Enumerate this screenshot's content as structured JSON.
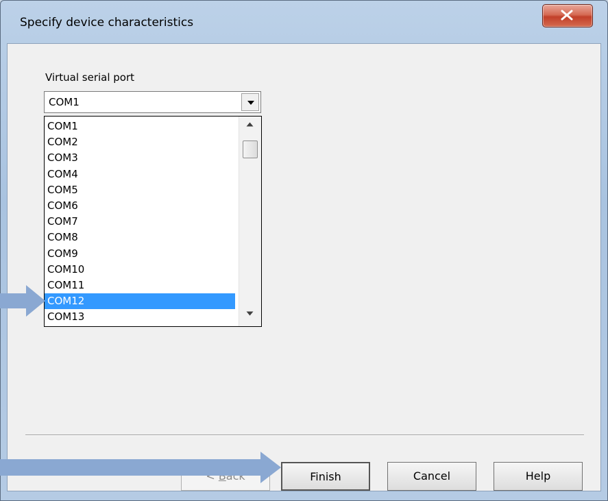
{
  "window": {
    "title": "Specify device characteristics",
    "close_glyph": "x"
  },
  "serial_port": {
    "label": "Virtual serial port",
    "selected_value": "COM1",
    "options": [
      "COM1",
      "COM2",
      "COM3",
      "COM4",
      "COM5",
      "COM6",
      "COM7",
      "COM8",
      "COM9",
      "COM10",
      "COM11",
      "COM12",
      "COM13"
    ],
    "highlighted": "COM12"
  },
  "buttons": {
    "back_prefix": "< ",
    "back_underlined": "B",
    "back_rest": "ack",
    "finish": "Finish",
    "cancel": "Cancel",
    "help": "Help"
  },
  "colors": {
    "selection": "#3399ff",
    "annotation_arrow": "#8aa8d2",
    "close_button": "#c2402a"
  },
  "icons": {
    "close": "close-icon",
    "dropdown": "chevron-down-icon",
    "pointer_arrows": "annotation-arrow-icon"
  }
}
